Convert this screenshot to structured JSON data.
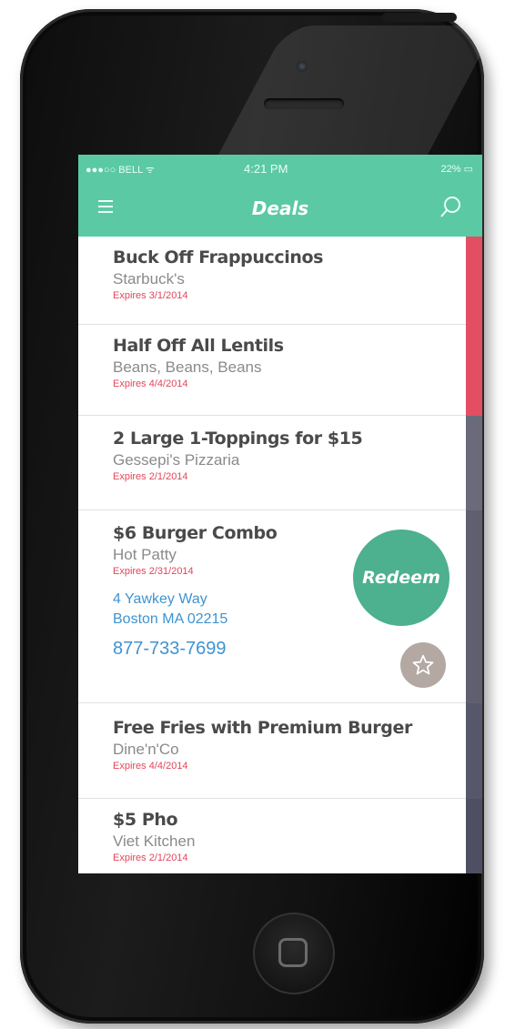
{
  "status_bar": {
    "carrier": "●●●○○ BELL ᯤ",
    "time": "4:21 PM",
    "battery": "22% ▭"
  },
  "navbar": {
    "title": "Deals"
  },
  "deals": [
    {
      "title": "Buck Off Frappuccinos",
      "merchant": "Starbuck's",
      "expires": "Expires 3/1/2014"
    },
    {
      "title": "Half Off All Lentils",
      "merchant": "Beans, Beans, Beans",
      "expires": "Expires 4/4/2014"
    },
    {
      "title": "2 Large 1-Toppings for $15",
      "merchant": "Gessepi's Pizzaria",
      "expires": "Expires 2/1/2014"
    },
    {
      "title": "$6 Burger Combo",
      "merchant": "Hot Patty",
      "expires": "Expires 2/31/2014",
      "address_line1": "4 Yawkey Way",
      "address_line2": "Boston MA 02215",
      "phone": "877-733-7699",
      "redeem_label": "Redeem"
    },
    {
      "title": "Free Fries with Premium Burger",
      "merchant": "Dine'n'Co",
      "expires": "Expires 4/4/2014"
    },
    {
      "title": "$5 Pho",
      "merchant": "Viet Kitchen",
      "expires": "Expires 2/1/2014"
    }
  ],
  "colors": {
    "accent": "#5bc9a3",
    "redeem": "#4db08e",
    "expires": "#e2465a",
    "link": "#3f93d1",
    "sidebar": [
      "#e34e63",
      "#e34e63",
      "#6a6a7a",
      "#5f5f70",
      "#57576b",
      "#4f4f63"
    ]
  },
  "icons": {
    "menu": "hamburger-icon",
    "search": "search-icon",
    "favorite": "star-icon"
  }
}
